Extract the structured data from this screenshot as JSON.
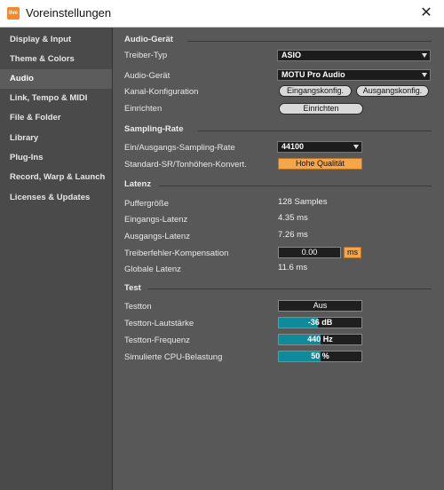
{
  "window": {
    "title": "Voreinstellungen",
    "app_icon_text": "live"
  },
  "sidebar": {
    "items": [
      {
        "label": "Display & Input"
      },
      {
        "label": "Theme & Colors"
      },
      {
        "label": "Audio"
      },
      {
        "label": "Link, Tempo & MIDI"
      },
      {
        "label": "File & Folder"
      },
      {
        "label": "Library"
      },
      {
        "label": "Plug-Ins"
      },
      {
        "label": "Record, Warp & Launch"
      },
      {
        "label": "Licenses & Updates"
      }
    ],
    "active": "Audio"
  },
  "audio_device": {
    "section": "Audio-Gerät",
    "driver_type_label": "Treiber-Typ",
    "driver_type_value": "ASIO",
    "device_label": "Audio-Gerät",
    "device_value": "MOTU Pro Audio",
    "channel_config_label": "Kanal-Konfiguration",
    "input_config_button": "Eingangskonfig.",
    "output_config_button": "Ausgangskonfig.",
    "setup_label": "Einrichten",
    "setup_button": "Einrichten"
  },
  "sampling": {
    "section": "Sampling-Rate",
    "io_rate_label": "Ein/Ausgangs-Sampling-Rate",
    "io_rate_value": "44100",
    "default_sr_label": "Standard-SR/Tonhöhen-Konvert.",
    "default_sr_value": "Hohe Qualität"
  },
  "latency": {
    "section": "Latenz",
    "buffer_label": "Puffergröße",
    "buffer_value": "128 Samples",
    "input_latency_label": "Eingangs-Latenz",
    "input_latency_value": "4.35 ms",
    "output_latency_label": "Ausgangs-Latenz",
    "output_latency_value": "7.26 ms",
    "driver_error_label": "Treiberfehler-Kompensation",
    "driver_error_value": "0.00",
    "driver_error_unit": "ms",
    "overall_label": "Globale Latenz",
    "overall_value": "11.6 ms"
  },
  "test": {
    "section": "Test",
    "tone_label": "Testton",
    "tone_value": "Aus",
    "volume_label": "Testton-Lautstärke",
    "volume_value": "-36 dB",
    "volume_fill": 0.47,
    "frequency_label": "Testton-Frequenz",
    "frequency_value": "440 Hz",
    "frequency_fill": 0.5,
    "cpu_label": "Simulierte CPU-Belastung",
    "cpu_value": "50 %",
    "cpu_fill": 0.5
  },
  "colors": {
    "accent_orange": "#f5a54a",
    "slider_teal": "#0e8a9a"
  }
}
